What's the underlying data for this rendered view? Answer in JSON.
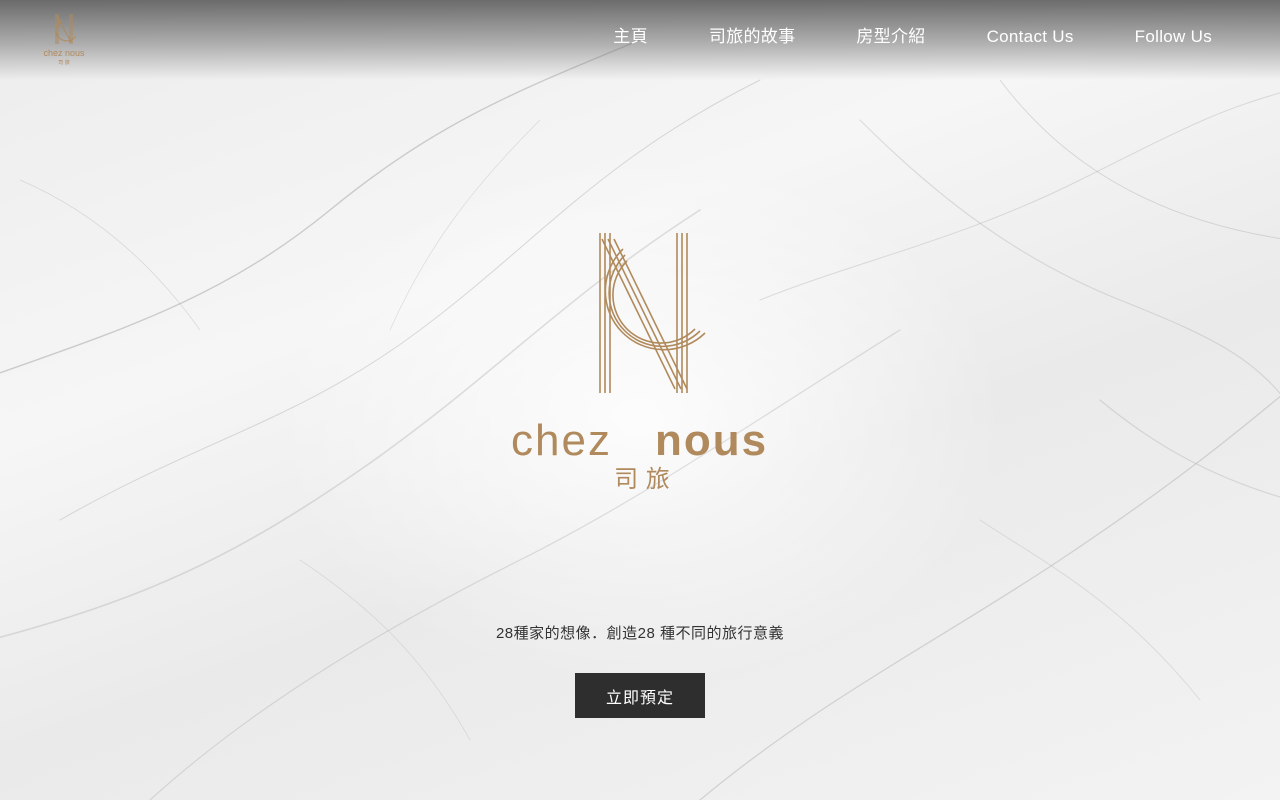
{
  "nav": {
    "items": [
      {
        "label": "主頁"
      },
      {
        "label": "司旅的故事"
      },
      {
        "label": "房型介紹"
      },
      {
        "label": "Contact Us"
      },
      {
        "label": "Follow Us"
      }
    ]
  },
  "brand": {
    "name_latin_light": "chez",
    "name_latin_bold": "nous",
    "name_chinese": "司 旅",
    "small_name": "chez nous",
    "small_chinese": "司 旅",
    "logo_color": "#b08a5c"
  },
  "hero": {
    "tagline": "28種家的想像．創造28 種不同的旅行意義",
    "cta_label": "立即預定"
  },
  "colors": {
    "button_bg": "#2e2e2e",
    "nav_text": "#ffffff"
  }
}
